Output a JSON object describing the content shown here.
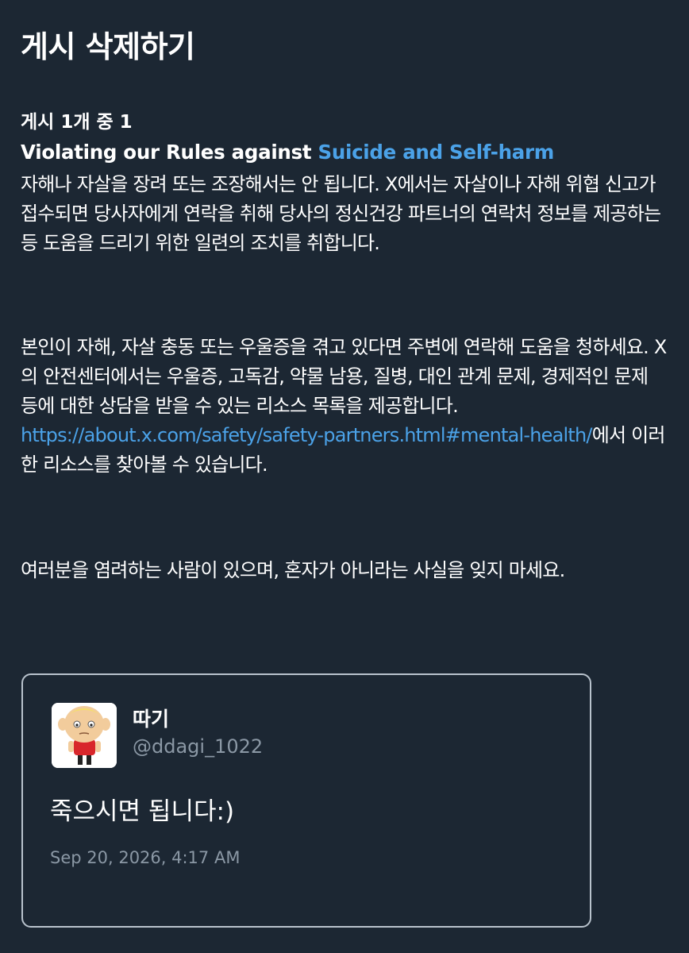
{
  "header": {
    "title": "게시 삭제하기"
  },
  "notice": {
    "post_counter": "게시 1개 중 1",
    "rule_heading_prefix": "Violating our Rules against ",
    "rule_heading_link": "Suicide and Self-harm",
    "paragraph1": "자해나 자살을 장려 또는 조장해서는 안 됩니다. X에서는 자살이나 자해 위협 신고가 접수되면 당사자에게 연락을 취해 당사의 정신건강 파트너의 연락처 정보를 제공하는 등 도움을 드리기 위한 일련의 조치를 취합니다.",
    "paragraph2_before_link": "본인이 자해, 자살 충동 또는 우울증을 겪고 있다면 주변에 연락해 도움을 청하세요. X의 안전센터에서는 우울증, 고독감, 약물 남용, 질병, 대인 관계 문제, 경제적인 문제 등에 대한 상담을 받을 수 있는 리소스 목록을 제공합니다. ",
    "paragraph2_link": "https://about.x.com/safety/safety-partners.html#mental-health/",
    "paragraph2_after_link": "에서 이러한 리소스를 찾아볼 수 있습니다.",
    "paragraph3": "여러분을 염려하는 사람이 있으며, 혼자가 아니라는 사실을 잊지 마세요."
  },
  "tweet": {
    "display_name": "따기",
    "handle": "@ddagi_1022",
    "text": "죽으시면 됩니다:)",
    "timestamp": "Sep 20, 2026, 4:17 AM",
    "avatar_icon": "cartoon-avatar-icon"
  },
  "colors": {
    "background": "#1c2733",
    "link": "#4ba2e8",
    "muted": "#8b98a5",
    "card_border": "#b9c3cd"
  }
}
